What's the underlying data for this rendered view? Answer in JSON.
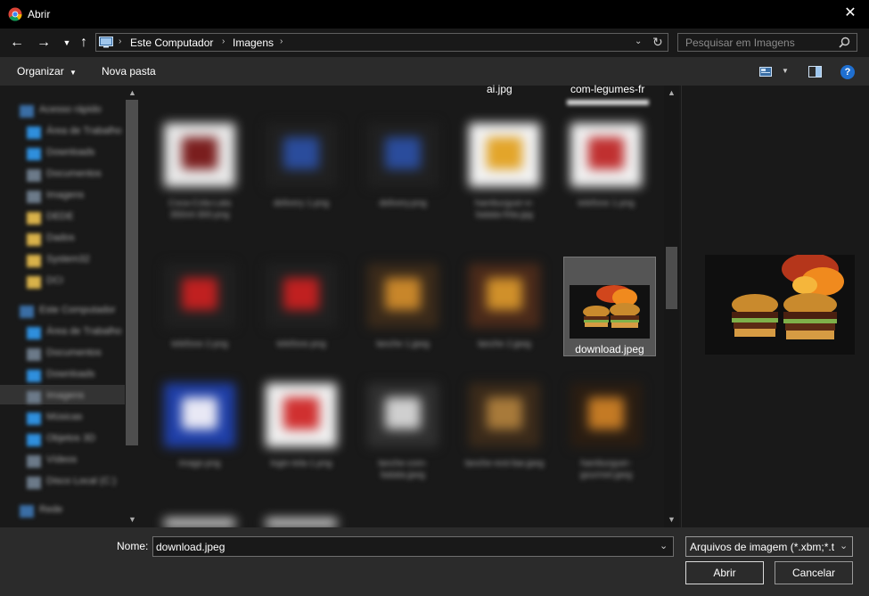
{
  "window": {
    "title": "Abrir"
  },
  "nav": {
    "path": [
      "Este Computador",
      "Imagens"
    ],
    "search_placeholder": "Pesquisar em Imagens"
  },
  "toolbar": {
    "organize": "Organizar",
    "new_folder": "Nova pasta",
    "help": "?"
  },
  "sidebar": {
    "items": [
      "Acesso rápido",
      "Área de Trabalho",
      "Downloads",
      "Documentos",
      "Imagens",
      "DEDE",
      "Dados",
      "System32",
      "DCI",
      "Este Computador",
      "Área de Trabalho",
      "Documentos",
      "Downloads",
      "Imagens",
      "Músicas",
      "Objetos 3D",
      "Vídeos",
      "Disco Local (C:)",
      "Rede"
    ]
  },
  "files": {
    "top_labels": [
      "ai.jpg",
      "com-legumes-fr"
    ],
    "items": [
      {
        "label": "Coca-Cola-Lata 350ml-300.png"
      },
      {
        "label": "delivery 1.png"
      },
      {
        "label": "delivery.png"
      },
      {
        "label": "hamburguer-e-batata-frita.jpg"
      },
      {
        "label": "telefone 1.png"
      },
      {
        "label": "telefone 2.png"
      },
      {
        "label": "telefone.png"
      },
      {
        "label": "lanche 1.jpeg"
      },
      {
        "label": "lanche 2.jpeg"
      },
      {
        "label": "download.jpeg"
      },
      {
        "label": "image.png"
      },
      {
        "label": "login-tela-1.png"
      },
      {
        "label": "lanche-com-batata.jpeg"
      },
      {
        "label": "lanche-rest-bar.jpeg"
      },
      {
        "label": "hamburguer-gourmet.jpeg"
      }
    ],
    "selected": "download.jpeg"
  },
  "footer": {
    "name_label": "Nome:",
    "name_value": "download.jpeg",
    "filter_value": "Arquivos de imagem (*.xbm;*.t",
    "open": "Abrir",
    "cancel": "Cancelar"
  }
}
